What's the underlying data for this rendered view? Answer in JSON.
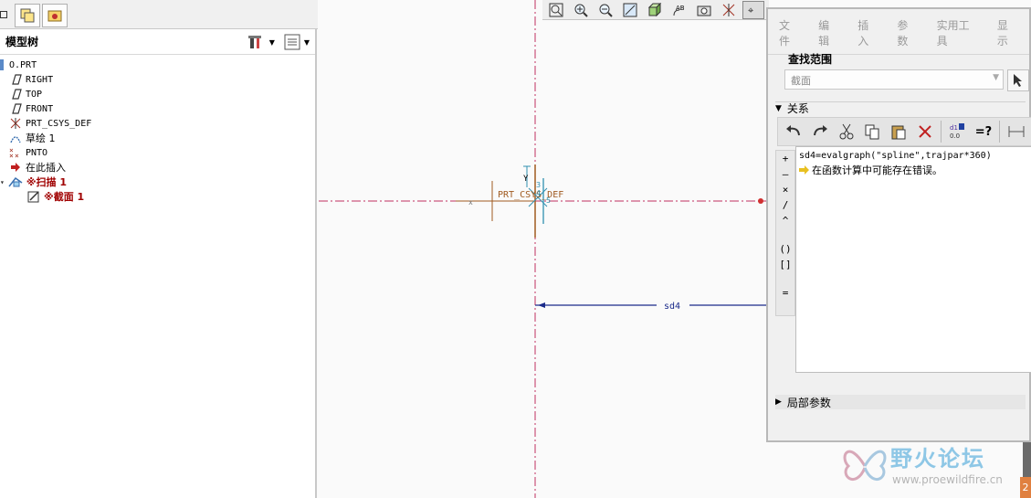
{
  "model_tree": {
    "title": "模型树",
    "items": [
      {
        "label": "O.PRT",
        "icon": "part-icon"
      },
      {
        "label": "RIGHT",
        "icon": "datum-plane-icon"
      },
      {
        "label": "TOP",
        "icon": "datum-plane-icon"
      },
      {
        "label": "FRONT",
        "icon": "datum-plane-icon"
      },
      {
        "label": "PRT_CSYS_DEF",
        "icon": "csys-icon"
      },
      {
        "label": "草绘 1",
        "icon": "sketch-icon"
      },
      {
        "label": "PNTO",
        "icon": "datum-point-icon"
      },
      {
        "label": "在此插入",
        "icon": "insert-arrow-icon"
      },
      {
        "label": "※扫描 1",
        "icon": "sweep-icon"
      },
      {
        "label": "※截面 1",
        "icon": "section-icon"
      }
    ]
  },
  "graphics": {
    "csys_label": "PRT_CSYS_DEF",
    "dim_label": "sd4",
    "axis_y": "Y",
    "axis_x": "x",
    "small_labels": [
      "3",
      "4",
      "5"
    ]
  },
  "relations_dialog": {
    "menu": [
      "文件",
      "编辑",
      "插入",
      "参数",
      "实用工具",
      "显示"
    ],
    "scope_title": "查找范围",
    "scope_value": "截面",
    "relations_section": "关系",
    "operators": [
      "+",
      "–",
      "×",
      "/",
      "^",
      "()",
      "[]",
      "="
    ],
    "relation_text": "sd4=evalgraph(\"spline\",trajpar*360)",
    "error_text": "在函数计算中可能存在错误。",
    "local_params_section": "局部参数"
  },
  "watermark": {
    "title": "野火论坛",
    "url": "www.proewildfire.cn"
  },
  "corner_tag": "2"
}
